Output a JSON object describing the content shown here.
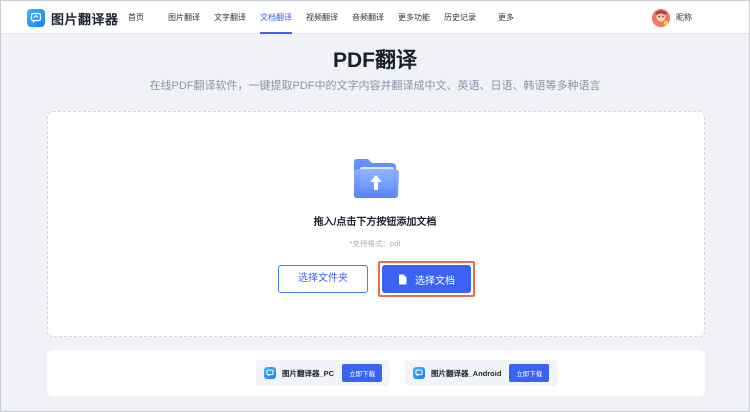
{
  "nav": {
    "logo": "图片翻译器",
    "items": [
      {
        "label": "首页"
      },
      {
        "label": "图片翻译"
      },
      {
        "label": "文字翻译"
      },
      {
        "label": "文档翻译"
      },
      {
        "label": "视频翻译"
      },
      {
        "label": "音频翻译"
      },
      {
        "label": "更多功能"
      },
      {
        "label": "历史记录"
      },
      {
        "label": "更多"
      }
    ],
    "active_index": 3,
    "user_name": "昵称"
  },
  "hero": {
    "title": "PDF翻译",
    "subtitle": "在线PDF翻译软件，一键提取PDF中的文字内容并翻译成中文、英语、日语、韩语等多种语言"
  },
  "upload": {
    "drop_text": "拖入/点击下方按钮添加文档",
    "support_text": "*支持格式：pdf",
    "select_folder": "选择文件夹",
    "select_file": "选择文档"
  },
  "downloads": [
    {
      "name": "图片翻译器_PC",
      "button": "立即下载"
    },
    {
      "name": "图片翻译器_Android",
      "button": "立即下载"
    }
  ],
  "colors": {
    "accent": "#3a63f3",
    "highlight": "#ee6a4b"
  },
  "icons": {
    "logo": "translate-logo-icon",
    "upload": "folder-upload-icon",
    "document": "document-icon"
  }
}
